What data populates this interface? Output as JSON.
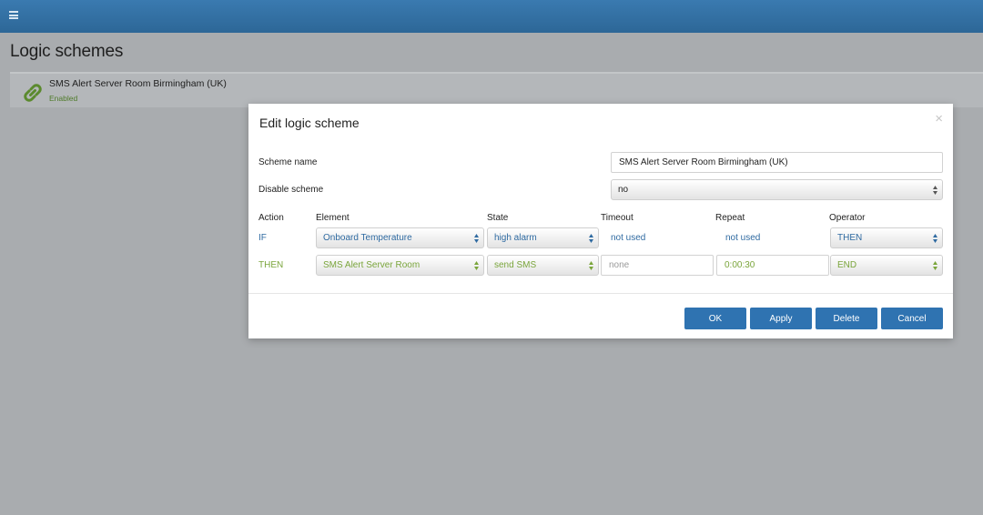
{
  "header": {
    "menu_icon": "hamburger-menu-icon"
  },
  "page": {
    "title": "Logic schemes"
  },
  "scheme_list": {
    "items": [
      {
        "name": "SMS Alert Server Room Birmingham (UK)",
        "status": "Enabled",
        "icon": "link-chain-icon",
        "status_color": "#4f7b2a"
      }
    ]
  },
  "modal": {
    "title": "Edit logic scheme",
    "close": "×",
    "scheme_name_label": "Scheme name",
    "scheme_name_value": "SMS Alert Server Room Birmingham (UK)",
    "disable_label": "Disable scheme",
    "disable_value": "no",
    "columns": {
      "action": "Action",
      "element": "Element",
      "state": "State",
      "timeout": "Timeout",
      "repeat": "Repeat",
      "operator": "Operator"
    },
    "rows": [
      {
        "action": "IF",
        "element": "Onboard Temperature",
        "state": "high alarm",
        "timeout": "not used",
        "repeat": "not used",
        "operator": "THEN",
        "color": "#2f6aa1"
      },
      {
        "action": "THEN",
        "element": "SMS Alert Server Room",
        "state": "send SMS",
        "timeout_placeholder": "none",
        "repeat": "0:00:30",
        "operator": "END",
        "color": "#7aa53b"
      }
    ],
    "buttons": {
      "ok": "OK",
      "apply": "Apply",
      "delete": "Delete",
      "cancel": "Cancel"
    },
    "accent": "#2f73b1"
  }
}
